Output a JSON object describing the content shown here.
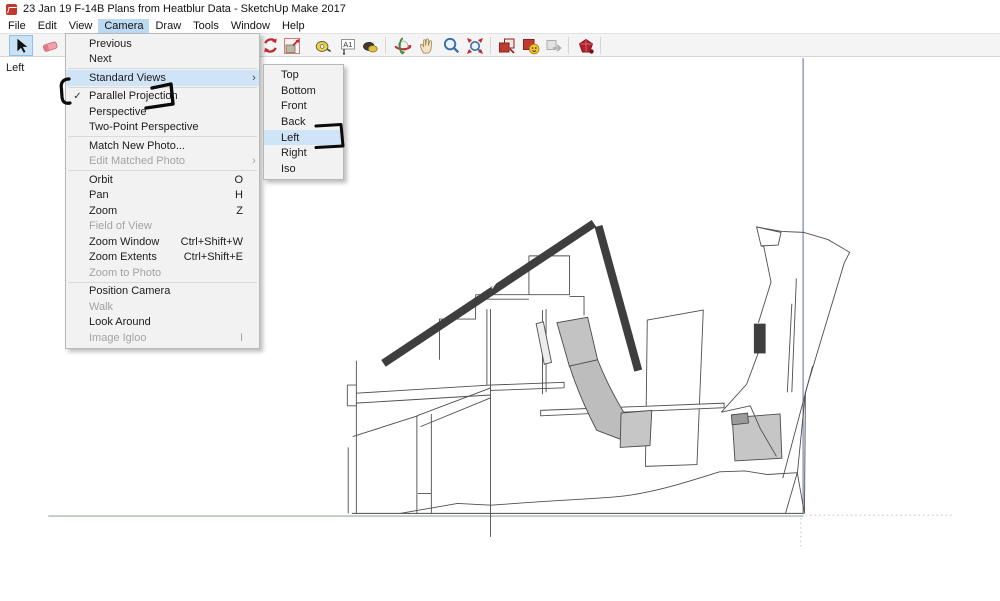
{
  "window": {
    "title": "23 Jan 19 F-14B Plans from Heatblur Data - SketchUp Make 2017"
  },
  "menubar": {
    "items": [
      "File",
      "Edit",
      "View",
      "Camera",
      "Draw",
      "Tools",
      "Window",
      "Help"
    ],
    "active_item": "Camera"
  },
  "toolbar": {
    "active_tool": "select",
    "tools": [
      "select",
      "eraser",
      "rotate",
      "scale",
      "tape-measure",
      "dimension",
      "paint-bucket",
      "orbit",
      "pan",
      "zoom",
      "zoom-extents",
      "make-component",
      "get-models",
      "share-model",
      "extension-warehouse"
    ]
  },
  "camera_menu": {
    "items": [
      {
        "label": "Previous"
      },
      {
        "label": "Next"
      },
      {
        "label": "Standard Views",
        "highlighted": true,
        "has_submenu": true
      },
      {
        "label": "Parallel Projection",
        "checked": true,
        "checkmark": "✓"
      },
      {
        "label": "Perspective"
      },
      {
        "label": "Two-Point Perspective"
      },
      {
        "label": "Match New Photo..."
      },
      {
        "label": "Edit Matched Photo",
        "disabled": true,
        "has_submenu": true
      },
      {
        "label": "Orbit",
        "shortcut": "O"
      },
      {
        "label": "Pan",
        "shortcut": "H"
      },
      {
        "label": "Zoom",
        "shortcut": "Z"
      },
      {
        "label": "Field of View",
        "disabled": true
      },
      {
        "label": "Zoom Window",
        "shortcut": "Ctrl+Shift+W"
      },
      {
        "label": "Zoom Extents",
        "shortcut": "Ctrl+Shift+E"
      },
      {
        "label": "Zoom to Photo",
        "disabled": true
      },
      {
        "label": "Position Camera"
      },
      {
        "label": "Walk",
        "disabled": true
      },
      {
        "label": "Look Around"
      },
      {
        "label": "Image Igloo",
        "disabled": true,
        "shortcut": "I"
      }
    ],
    "submenu_arrow": "›"
  },
  "standard_views_submenu": {
    "highlighted": "Left",
    "items": [
      {
        "label": "Top"
      },
      {
        "label": "Bottom"
      },
      {
        "label": "Front"
      },
      {
        "label": "Back"
      },
      {
        "label": "Left"
      },
      {
        "label": "Right"
      },
      {
        "label": "Iso"
      }
    ]
  },
  "viewport": {
    "view_label": "Left"
  },
  "colors": {
    "menu_highlight": "#cfe4f7",
    "menubar_highlight": "#bcd9f2",
    "axis_green": "#8fb08f",
    "axis_blue": "#8089bb",
    "annotation_ink": "#0b0b0b",
    "canopy_frame_dark": "#3e3e3e",
    "model_line": "#4f4f4f"
  }
}
